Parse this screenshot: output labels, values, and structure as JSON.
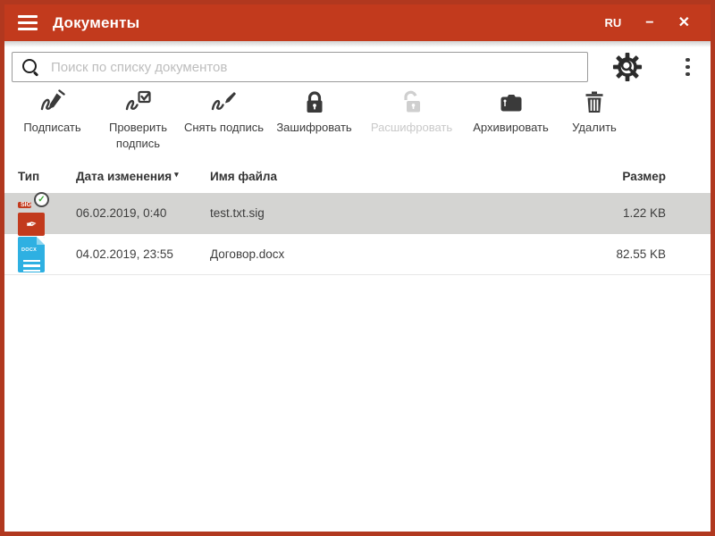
{
  "titlebar": {
    "title": "Документы",
    "language_badge": "RU",
    "minimize_glyph": "−",
    "close_glyph": "✕"
  },
  "search": {
    "placeholder": "Поиск по списку документов"
  },
  "toolbar": {
    "items": [
      {
        "label": "Подписать",
        "icon": "sign-icon"
      },
      {
        "label": "Проверить подпись",
        "icon": "verify-signature-icon"
      },
      {
        "label": "Снять подпись",
        "icon": "remove-signature-icon"
      },
      {
        "label": "Зашифровать",
        "icon": "encrypt-lock-icon"
      },
      {
        "label": "Расшифровать",
        "icon": "decrypt-unlock-icon",
        "disabled": true
      },
      {
        "label": "Архивировать",
        "icon": "archive-icon"
      },
      {
        "label": "Удалить",
        "icon": "delete-trash-icon"
      }
    ]
  },
  "table": {
    "columns": [
      "Тип",
      "Дата изменения",
      "Имя файла",
      "Размер"
    ],
    "sort": {
      "column": "Дата изменения",
      "indicator": "▾"
    },
    "rows": [
      {
        "type_label": "SIG",
        "signed_badge": "✓",
        "date": "06.02.2019, 0:40",
        "name": "test.txt.sig",
        "size": "1.22 KB",
        "selected": true
      },
      {
        "type_label": "DOCX",
        "date": "04.02.2019, 23:55",
        "name": "Договор.docx",
        "size": "82.55 KB",
        "selected": false
      }
    ]
  },
  "colors": {
    "accent_red": "#c23a1d",
    "window_border_red": "#b1381f",
    "selected_row_gray": "#d4d4d2",
    "docx_icon_blue": "#2eb0e2",
    "check_green": "#3aa636"
  }
}
